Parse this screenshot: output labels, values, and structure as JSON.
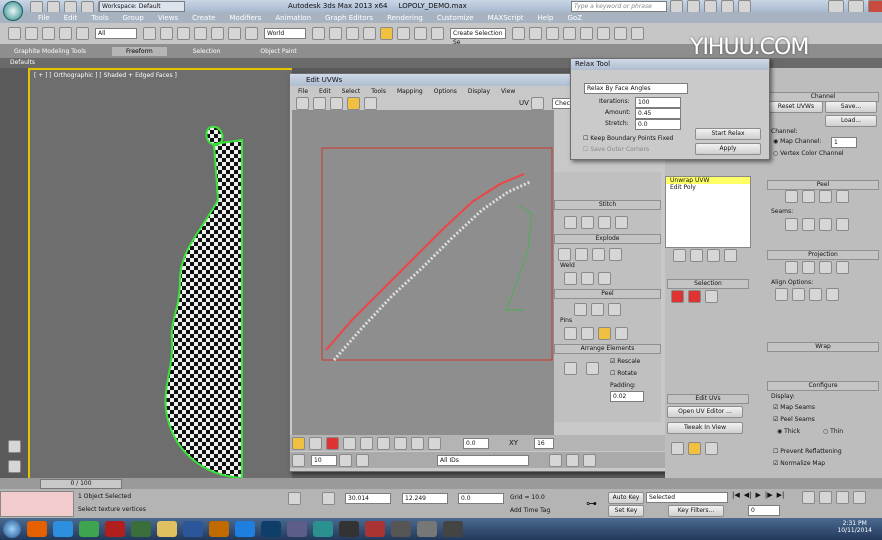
{
  "app": {
    "title": "Autodesk 3ds Max 2013 x64",
    "file": "LOPOLY_DEMO.max",
    "workspace": "Workspace: Default",
    "search_placeholder": "Type a keyword or phrase",
    "watermark": "YIHUU.COM"
  },
  "menu": [
    "File",
    "Edit",
    "Tools",
    "Group",
    "Views",
    "Create",
    "Modifiers",
    "Animation",
    "Graph Editors",
    "Rendering",
    "Customize",
    "MAXScript",
    "Help",
    "GoZ"
  ],
  "ribbon_tabs": [
    "Graphite Modeling Tools",
    "Freeform",
    "Selection",
    "Object Paint"
  ],
  "defaults_label": "Defaults",
  "toolbar": {
    "filter": "All",
    "coord": "World",
    "named_sel": "Create Selection Se"
  },
  "viewport": {
    "label": "[ + ] [ Orthographic ] [ Shaded + Edged Faces ]",
    "frame": "0 / 100"
  },
  "edit_uvws": {
    "title": "Edit UVWs",
    "menu": [
      "File",
      "Edit",
      "Select",
      "Tools",
      "Mapping",
      "Options",
      "Display",
      "View"
    ],
    "uv_label": "UV",
    "checker": "Checkerl",
    "sections": [
      "Stitch",
      "Explode",
      "Weld",
      "Peel",
      "Arrange Elements"
    ],
    "pins_label": "Pins",
    "rescale": "Rescale",
    "rotate": "Rotate",
    "padding_label": "Padding:",
    "padding_value": "0.02",
    "bottom_value1": "0.0",
    "xy_label": "XY",
    "bottom_value2": "16",
    "u_value": "10",
    "filter": "All IDs"
  },
  "relax_tool": {
    "title": "Relax Tool",
    "method": "Relax By Face Angles",
    "iterations_label": "Iterations:",
    "iterations_value": "100",
    "amount_label": "Amount:",
    "amount_value": "0.45",
    "stretch_label": "Stretch:",
    "stretch_value": "0.0",
    "keep_boundary": "Keep Boundary Points Fixed",
    "save_outer": "Save Outer Corners",
    "start_btn": "Start Relax",
    "apply_btn": "Apply"
  },
  "command_panel": {
    "stack_items": [
      "Unwrap UVW",
      "Edit Poly"
    ],
    "channel_title": "Channel",
    "reset_uvws": "Reset UVWs",
    "save": "Save...",
    "load": "Load...",
    "channel_label": "Channel:",
    "map_channel": "Map Channel:",
    "map_channel_value": "1",
    "vertex_color": "Vertex Color Channel",
    "peel_title": "Peel",
    "seams_label": "Seams:",
    "projection_title": "Projection",
    "align_label": "Align Options:",
    "wrap_title": "Wrap",
    "selection_title": "Selection",
    "edit_uvs_title": "Edit UVs",
    "open_uv_editor": "Open UV Editor ...",
    "tweak_in_view": "Tweak In View",
    "configure_title": "Configure",
    "display_label": "Display:",
    "map_seams": "Map Seams",
    "peel_seams": "Peel Seams",
    "thick": "Thick",
    "thin": "Thin",
    "prevent_reflattening": "Prevent Reflattening",
    "normalize_map": "Normalize Map"
  },
  "status": {
    "objects": "1 Object Selected",
    "prompt": "Select texture vertices",
    "x": "30.014",
    "y": "12.249",
    "z": "0.0",
    "grid": "Grid = 10.0",
    "add_time_tag": "Add Time Tag",
    "auto_key": "Auto Key",
    "set_key": "Set Key",
    "selected": "Selected",
    "key_filters": "Key Filters...",
    "frame": "0"
  },
  "taskbar": {
    "time": "2:31 PM",
    "date": "10/11/2014",
    "icons": [
      "start-orb",
      "firefox",
      "ie",
      "chrome",
      "filezilla",
      "dreamweaver",
      "folder",
      "word",
      "illustrator",
      "dropbox",
      "photoshop",
      "cinema",
      "3dsmax",
      "zbrush",
      "app",
      "app2",
      "app3",
      "app4"
    ]
  }
}
